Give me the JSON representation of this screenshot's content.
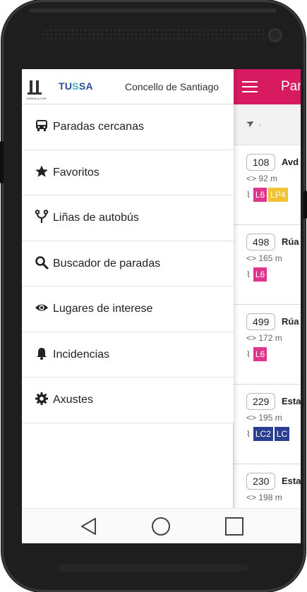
{
  "header": {
    "tussa_logo_prefix": "TU",
    "tussa_logo_s": "S",
    "tussa_logo_suffix": "SA",
    "title": "Concello de Santiago"
  },
  "menu": [
    {
      "label": "Paradas cercanas",
      "icon": "bus-icon"
    },
    {
      "label": "Favoritos",
      "icon": "star-icon"
    },
    {
      "label": "Liñas de autobús",
      "icon": "route-fork-icon"
    },
    {
      "label": "Buscador de paradas",
      "icon": "search-icon"
    },
    {
      "label": "Lugares de interese",
      "icon": "eye-icon"
    },
    {
      "label": "Incidencias",
      "icon": "bell-icon"
    },
    {
      "label": "Axustes",
      "icon": "gear-icon"
    }
  ],
  "app_bar": {
    "title": "Par"
  },
  "stops": [
    {
      "number": "108",
      "name": "Avd",
      "distance": "92 m",
      "lines": [
        {
          "label": "L6",
          "color": "#e0358e"
        },
        {
          "label": "LP4",
          "color": "#f1c232"
        }
      ]
    },
    {
      "number": "498",
      "name": "Rúa",
      "distance": "165 m",
      "lines": [
        {
          "label": "L6",
          "color": "#e0358e"
        }
      ]
    },
    {
      "number": "499",
      "name": "Rúa",
      "distance": "172 m",
      "lines": [
        {
          "label": "L6",
          "color": "#e0358e"
        }
      ]
    },
    {
      "number": "229",
      "name": "Esta",
      "distance": "195 m",
      "lines": [
        {
          "label": "LC2",
          "color": "#2c3e8f"
        },
        {
          "label": "LC",
          "color": "#2c3e8f"
        }
      ]
    },
    {
      "number": "230",
      "name": "Esta",
      "distance": "198 m",
      "lines": []
    }
  ],
  "colors": {
    "accent": "#d81b60",
    "line_pink": "#e0358e",
    "line_yellow": "#f1c232",
    "line_blue": "#2c3e8f"
  }
}
